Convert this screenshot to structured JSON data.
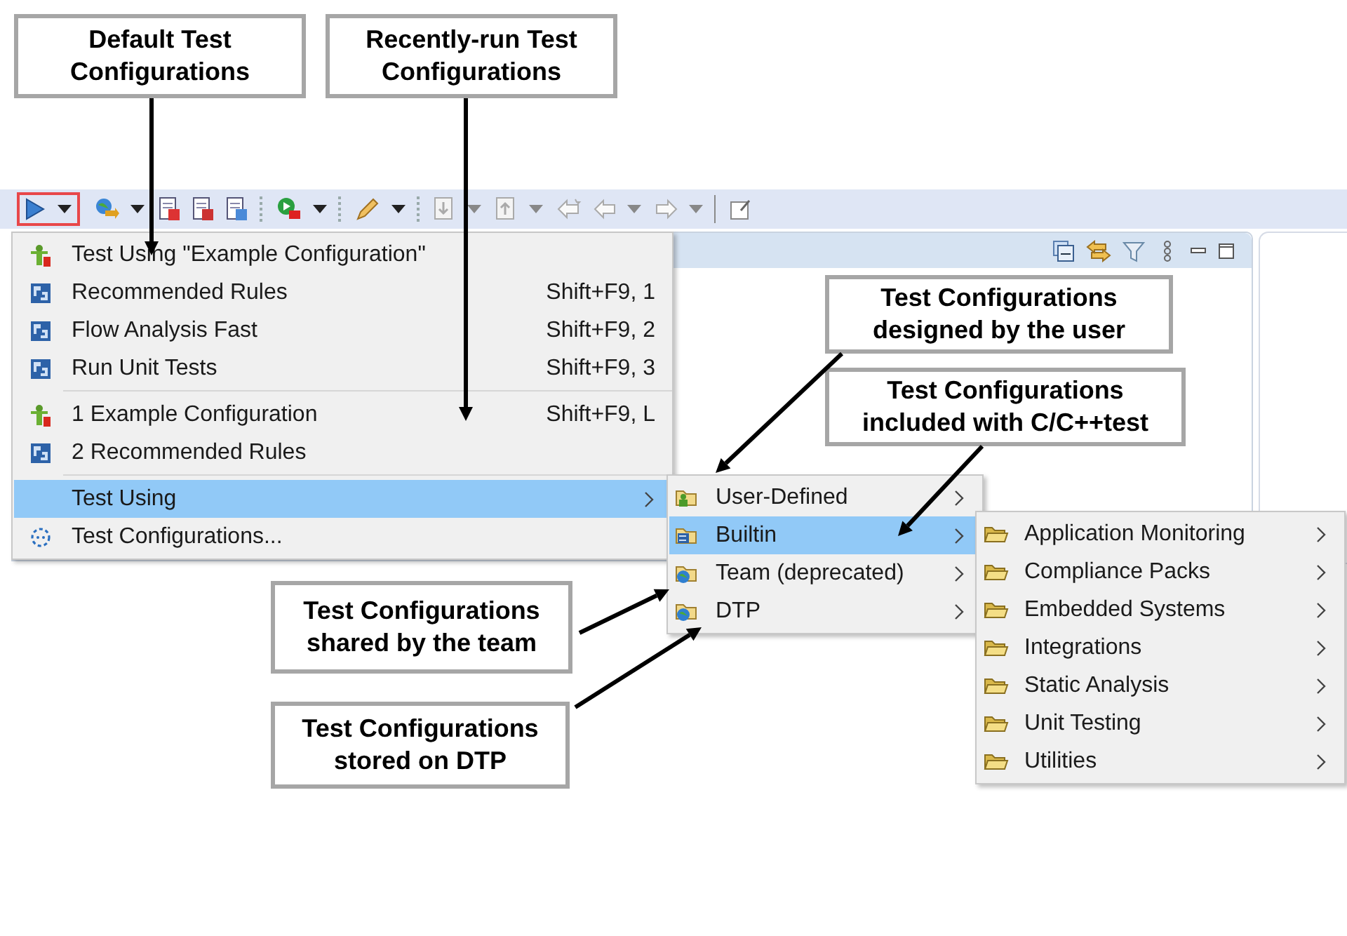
{
  "callouts": [
    {
      "text": "Default Test Configurations"
    },
    {
      "text": "Recently-run Test Configurations"
    },
    {
      "text": "Test Configurations designed by the user"
    },
    {
      "text": "Test Configurations included with C/C++test"
    },
    {
      "text": "Test Configurations shared by the team"
    },
    {
      "text": "Test Configurations stored on DTP"
    }
  ],
  "toolbar": {
    "run_button_highlighted": true
  },
  "menu": {
    "items": [
      {
        "kind": "user-config",
        "label": "Test Using \"Example Configuration\"",
        "selected": false
      },
      {
        "kind": "builtin-config",
        "label": "Recommended Rules",
        "shortcut": "Shift+F9, 1",
        "selected": false
      },
      {
        "kind": "builtin-config",
        "label": "Flow Analysis Fast",
        "shortcut": "Shift+F9, 2",
        "selected": false
      },
      {
        "kind": "builtin-config",
        "label": "Run Unit Tests",
        "shortcut": "Shift+F9, 3",
        "selected": false
      },
      {
        "kind": "separator"
      },
      {
        "kind": "user-config",
        "label": "1 Example Configuration",
        "shortcut": "Shift+F9, L",
        "selected": false
      },
      {
        "kind": "builtin-config",
        "label": "2 Recommended Rules",
        "selected": false
      },
      {
        "kind": "separator"
      },
      {
        "kind": "submenu",
        "label": "Test Using",
        "selected": true
      },
      {
        "kind": "dialog",
        "label": "Test Configurations...",
        "selected": false
      }
    ]
  },
  "test_using_submenu": {
    "items": [
      {
        "kind": "user-folder",
        "label": "User-Defined",
        "selected": false
      },
      {
        "kind": "builtin-folder",
        "label": "Builtin",
        "selected": true
      },
      {
        "kind": "team-folder",
        "label": "Team (deprecated)",
        "selected": false
      },
      {
        "kind": "dtp-folder",
        "label": "DTP",
        "selected": false
      }
    ]
  },
  "builtin_submenu": {
    "items": [
      {
        "kind": "folder",
        "label": "Application Monitoring",
        "selected": false
      },
      {
        "kind": "folder",
        "label": "Compliance Packs",
        "selected": false
      },
      {
        "kind": "folder",
        "label": "Embedded Systems",
        "selected": false
      },
      {
        "kind": "folder",
        "label": "Integrations",
        "selected": false
      },
      {
        "kind": "folder",
        "label": "Static Analysis",
        "selected": false
      },
      {
        "kind": "folder",
        "label": "Unit Testing",
        "selected": false
      },
      {
        "kind": "folder",
        "label": "Utilities",
        "selected": false
      }
    ]
  }
}
